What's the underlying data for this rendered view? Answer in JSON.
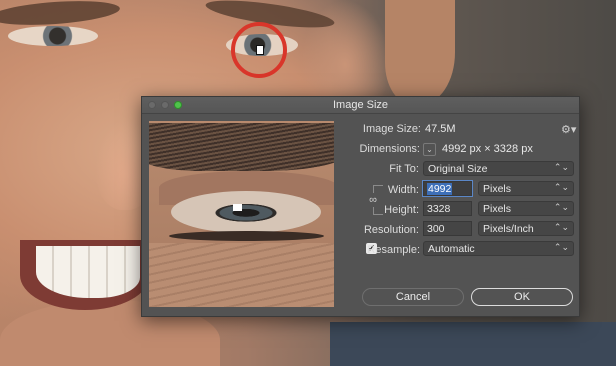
{
  "dialog": {
    "title": "Image Size",
    "image_size_label": "Image Size:",
    "image_size_value": "47.5M",
    "dimensions_label": "Dimensions:",
    "dimensions_value": "4992 px  ×  3328 px",
    "fit_to_label": "Fit To:",
    "fit_to_value": "Original Size",
    "width_label": "Width:",
    "width_value": "4992",
    "width_unit": "Pixels",
    "height_label": "Height:",
    "height_value": "3328",
    "height_unit": "Pixels",
    "resolution_label": "Resolution:",
    "resolution_value": "300",
    "resolution_unit": "Pixels/Inch",
    "resample_label": "Resample:",
    "resample_checked": true,
    "resample_value": "Automatic",
    "cancel_label": "Cancel",
    "ok_label": "OK"
  },
  "icons": {
    "gear": "gear-icon",
    "chevron": "chevron-down-icon",
    "link": "chain-link-icon",
    "check": "checkmark-icon"
  },
  "colors": {
    "dialog_bg": "#535353",
    "highlight": "#3d6fb8",
    "annotation_ring": "#d9362a",
    "zoom_button": "#4fc24b"
  }
}
